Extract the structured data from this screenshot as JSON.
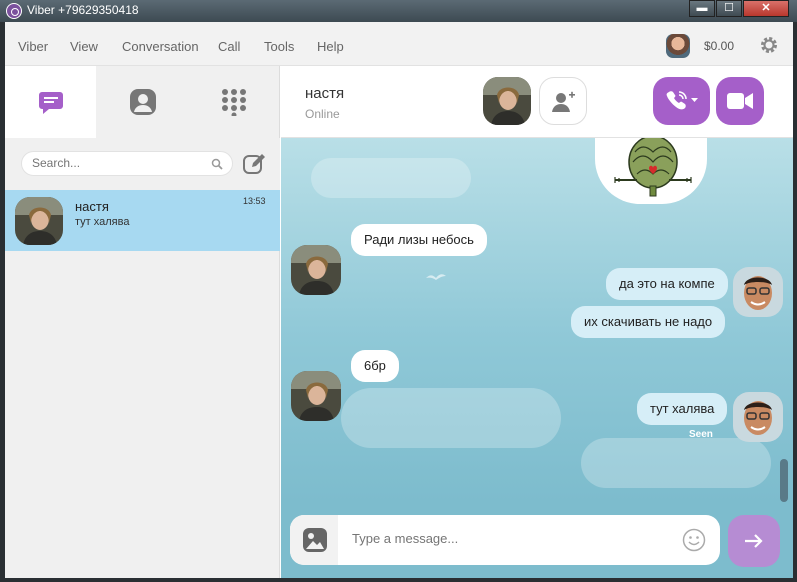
{
  "window": {
    "title": "Viber +79629350418",
    "minimize_label": "▬",
    "maximize_label": "☐",
    "close_label": "✕"
  },
  "menu": {
    "items": [
      "Viber",
      "View",
      "Conversation",
      "Call",
      "Tools",
      "Help"
    ],
    "balance": "$0.00"
  },
  "sidebar": {
    "tabs": [
      {
        "name": "chats",
        "icon": "chat-bubble-icon",
        "active": true
      },
      {
        "name": "contacts",
        "icon": "contact-icon",
        "active": false
      },
      {
        "name": "dialpad",
        "icon": "dialpad-icon",
        "active": false
      }
    ],
    "search_placeholder": "Search...",
    "chats": [
      {
        "name": "настя",
        "preview": "тут халява",
        "time": "13:53",
        "selected": true
      }
    ]
  },
  "conversation": {
    "name": "настя",
    "status": "Online",
    "messages": [
      {
        "direction": "in",
        "text": "Ради лизы небось"
      },
      {
        "direction": "out",
        "text": "да это на компе"
      },
      {
        "direction": "out",
        "text": "их скачивать не надо"
      },
      {
        "direction": "in",
        "text": "6бр"
      },
      {
        "direction": "out",
        "text": "тут халява"
      }
    ],
    "seen_label": "Seen",
    "compose_placeholder": "Type a message..."
  },
  "colors": {
    "accent": "#a55fc9",
    "selected_chat": "#a7d9f1",
    "background": "#8fc8d7"
  }
}
